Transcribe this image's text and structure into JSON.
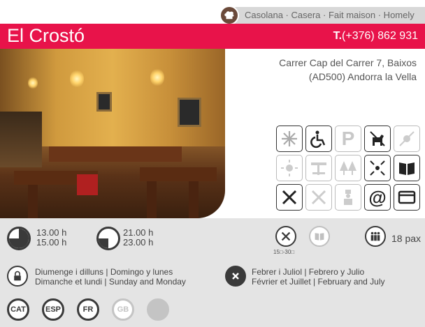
{
  "cuisine": {
    "text": "Casolana · Casera · Fait maison · Homely"
  },
  "header": {
    "name": "El Crostó",
    "phone_prefix": "T.",
    "phone": "(+376) 862 931"
  },
  "address": {
    "line1": "Carrer Cap del Carrer 7, Baixos",
    "line2": "(AD500) Andorra la Vella"
  },
  "facilities": [
    {
      "icon": "snowflake-icon",
      "active": true
    },
    {
      "icon": "wheelchair-icon",
      "active": true
    },
    {
      "icon": "parking-icon",
      "label": "P",
      "active": false
    },
    {
      "icon": "no-dogs-icon",
      "active": true
    },
    {
      "icon": "sun-crossed-icon",
      "active": false
    },
    {
      "icon": "sun-icon",
      "active": false
    },
    {
      "icon": "terrace-icon",
      "active": false
    },
    {
      "icon": "trees-icon",
      "active": false
    },
    {
      "icon": "children-icon",
      "active": true
    },
    {
      "icon": "menu-book-icon",
      "active": true
    },
    {
      "icon": "knife-fork-icon",
      "active": true
    },
    {
      "icon": "no-cutlery-icon",
      "active": false
    },
    {
      "icon": "chef-icon",
      "active": false
    },
    {
      "icon": "at-icon",
      "label": "@",
      "active": true
    },
    {
      "icon": "credit-card-icon",
      "active": true
    }
  ],
  "hours": {
    "lunch": [
      "13.00 h",
      "15.00 h"
    ],
    "dinner": [
      "21.00 h",
      "23.00 h"
    ]
  },
  "price": {
    "range_label": "15□-30□"
  },
  "capacity": {
    "value": "18 pax"
  },
  "closed_days": {
    "line1": "Diumenge i dilluns | Domingo y lunes",
    "line2": "Dimanche et lundi | Sunday and Monday"
  },
  "closed_months": {
    "line1": "Febrer i Juliol | Febrero y Julio",
    "line2": "Février et Juillet | February and July"
  },
  "languages": [
    {
      "code": "CAT",
      "active": true
    },
    {
      "code": "ESP",
      "active": true
    },
    {
      "code": "FR",
      "active": true
    },
    {
      "code": "GB",
      "active": false
    },
    {
      "code": "",
      "active": false
    }
  ],
  "colors": {
    "accent": "#e8134a",
    "info_bg": "#e4e4e4",
    "icon_dark": "#3a3a3a"
  }
}
